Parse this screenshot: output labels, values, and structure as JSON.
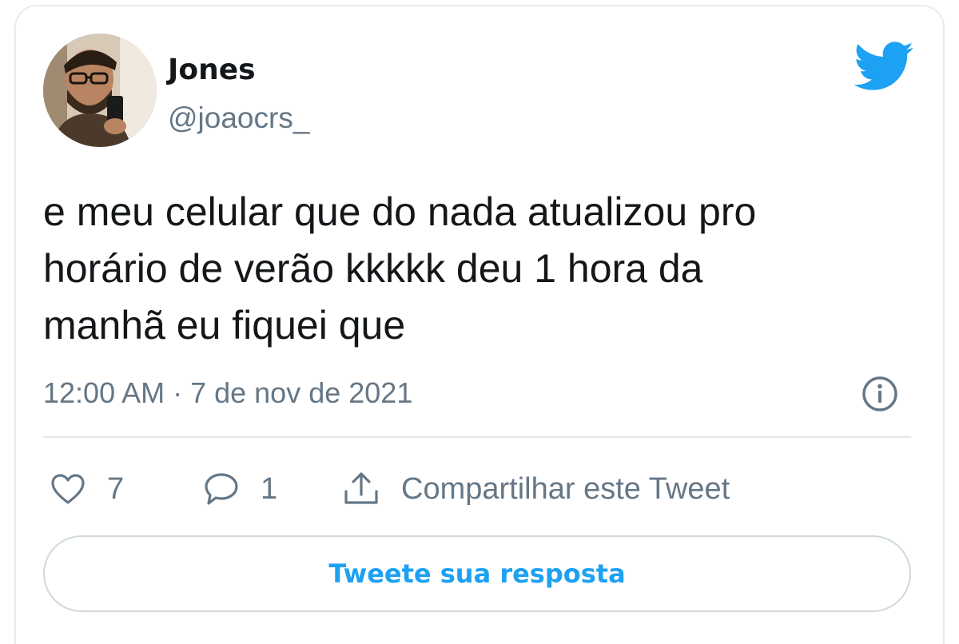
{
  "author": {
    "display_name": "Jones",
    "handle": "@joaocrs_"
  },
  "tweet": {
    "text": "e meu celular que do nada atualizou pro\nhorário de verão kkkkk deu 1 hora da\nmanhã eu fiquei que",
    "timestamp": "12:00 AM · 7 de nov de 2021"
  },
  "actions": {
    "like_count": "7",
    "reply_count": "1",
    "share_label": "Compartilhar este Tweet"
  },
  "reply": {
    "label": "Tweete sua resposta"
  },
  "colors": {
    "brand": "#1da1f2",
    "text_primary": "#14171a",
    "text_secondary": "#657786"
  },
  "icons": {
    "logo": "twitter-bird-icon",
    "info": "info-icon",
    "like": "heart-icon",
    "reply": "speech-bubble-icon",
    "share": "share-upload-icon"
  }
}
